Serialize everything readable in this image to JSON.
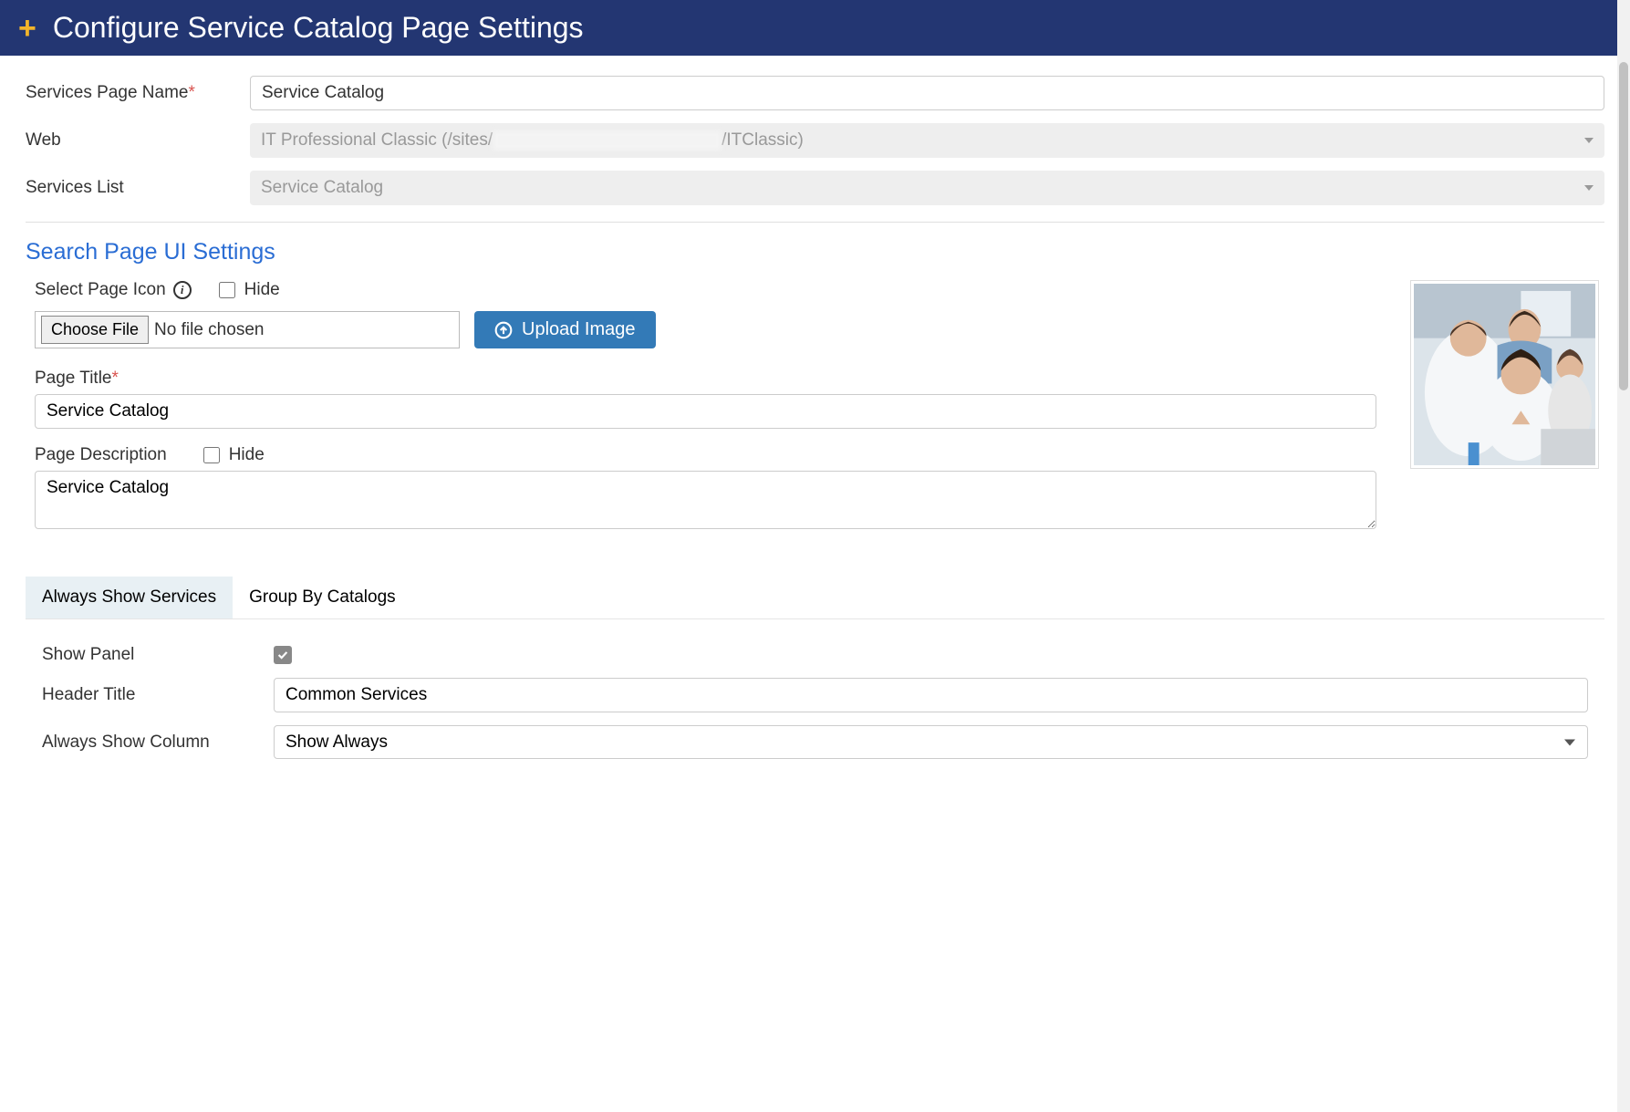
{
  "header": {
    "title": "Configure Service Catalog Page Settings"
  },
  "form": {
    "servicesPageName": {
      "label": "Services Page Name",
      "value": "Service Catalog"
    },
    "web": {
      "label": "Web",
      "prefix": "IT Professional Classic (/sites/",
      "redacted": "xxxxxxxxxxxxxxxxxxxxxxxxxx",
      "suffix": "/ITClassic)"
    },
    "servicesList": {
      "label": "Services List",
      "value": "Service Catalog"
    }
  },
  "uiSettings": {
    "sectionTitle": "Search Page UI Settings",
    "selectPageIcon": {
      "label": "Select Page Icon",
      "hideLabel": "Hide"
    },
    "file": {
      "chooseLabel": "Choose File",
      "status": "No file chosen",
      "uploadLabel": "Upload Image"
    },
    "pageTitle": {
      "label": "Page Title",
      "value": "Service Catalog"
    },
    "pageDescription": {
      "label": "Page Description",
      "hideLabel": "Hide",
      "value": "Service Catalog"
    }
  },
  "tabs": {
    "items": [
      {
        "label": "Always Show Services",
        "active": true
      },
      {
        "label": "Group By Catalogs",
        "active": false
      }
    ]
  },
  "tabContent": {
    "showPanel": {
      "label": "Show Panel",
      "checked": true
    },
    "headerTitle": {
      "label": "Header Title",
      "value": "Common Services"
    },
    "alwaysShowColumn": {
      "label": "Always Show Column",
      "value": "Show Always"
    }
  }
}
